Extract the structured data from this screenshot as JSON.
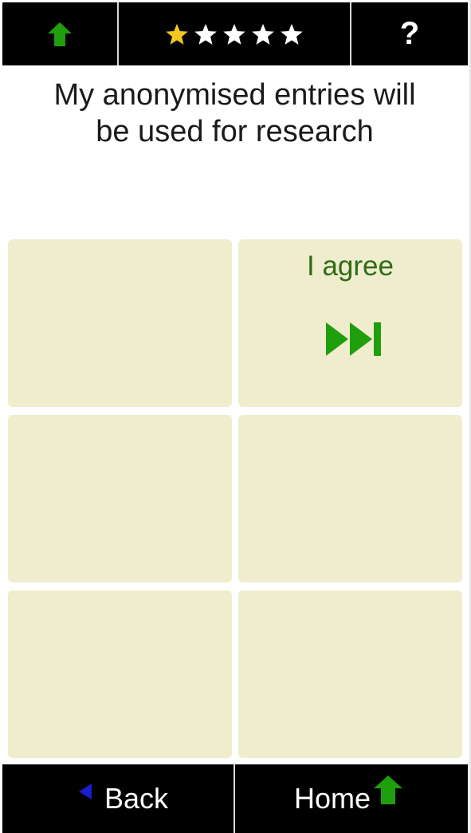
{
  "header": {
    "home_icon": "home-up-arrow-icon",
    "rating": {
      "filled": 1,
      "total": 5
    },
    "help_label": "?"
  },
  "prompt": {
    "line1": "My anonymised entries will",
    "line2": "be used for research"
  },
  "options": [
    {
      "label": ""
    },
    {
      "label": "I agree",
      "icon": "fast-forward-icon"
    },
    {
      "label": ""
    },
    {
      "label": ""
    },
    {
      "label": ""
    },
    {
      "label": ""
    }
  ],
  "footer": {
    "back_label": "Back",
    "home_label": "Home"
  },
  "colors": {
    "accent_green": "#1f9e0e",
    "back_arrow_blue": "#1c1ccc",
    "tile_bg": "#efedcd",
    "star_filled": "#f2c81c",
    "star_empty": "#ffffff"
  }
}
